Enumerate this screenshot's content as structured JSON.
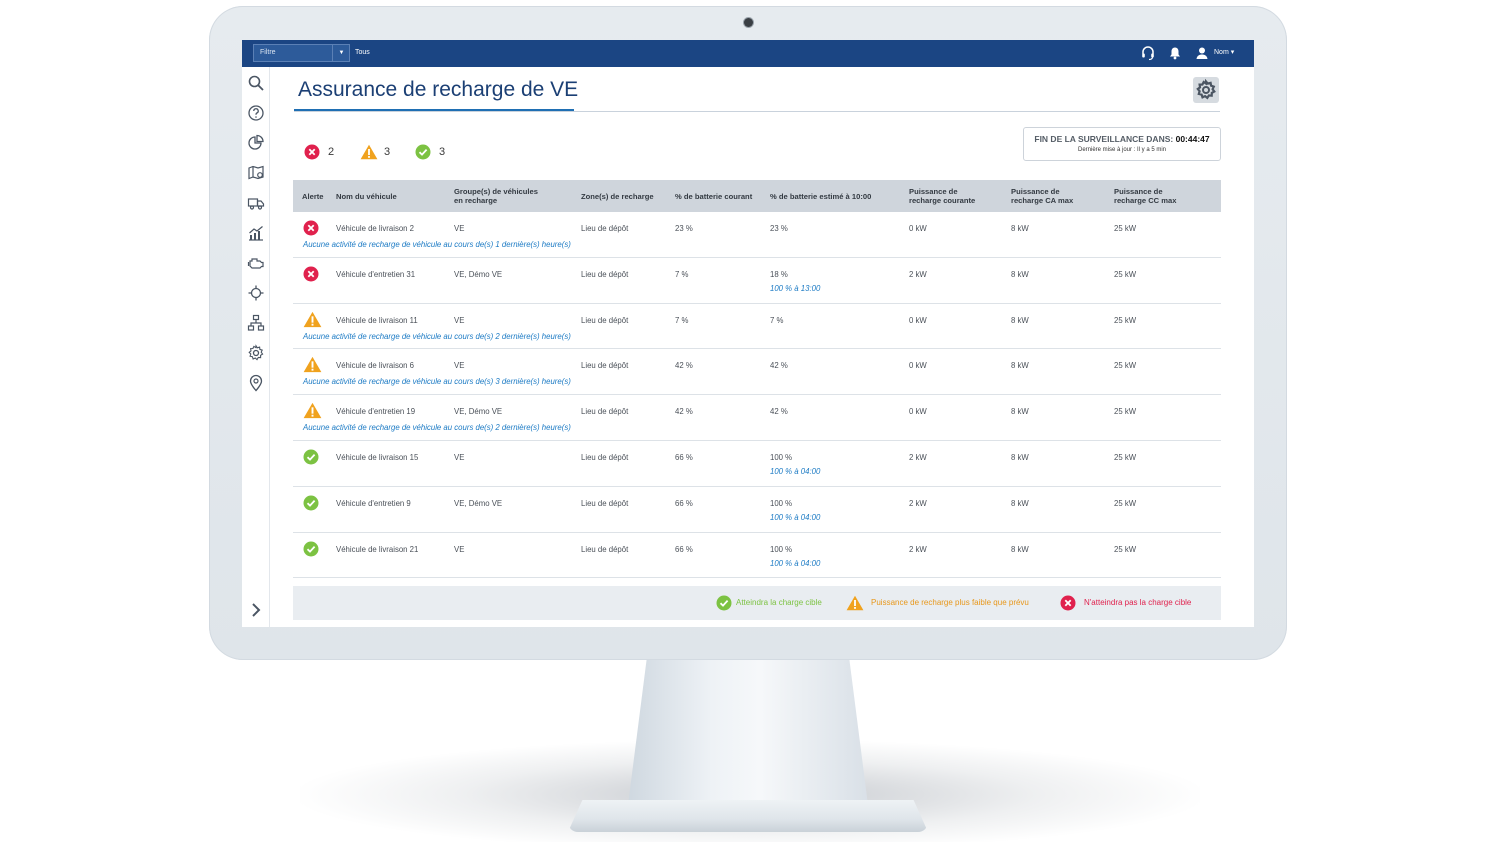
{
  "topbar": {
    "filter_label": "Filtre",
    "filter_value": "Tous",
    "user_name": "Nom ▾"
  },
  "page": {
    "title": "Assurance de recharge de VE"
  },
  "counters": {
    "red": "2",
    "orange": "3",
    "green": "3"
  },
  "timer": {
    "label": "FIN DE LA SURVEILLANCE DANS:",
    "value": "00:44:47",
    "last_update": "Dernière mise à jour : Il y a 5 min"
  },
  "table": {
    "headers": {
      "alert": "Alerte",
      "name": "Nom du véhicule",
      "groups_l1": "Groupe(s) de véhicules",
      "groups_l2": "en recharge",
      "zone": "Zone(s) de recharge",
      "battery": "% de batterie courant",
      "estimated": "% de batterie estimé à 10:00",
      "power_l1": "Puissance de",
      "power_l2": "recharge courante",
      "ac_l1": "Puissance de",
      "ac_l2": "recharge CA max",
      "dc_l1": "Puissance de",
      "dc_l2": "recharge CC max"
    },
    "rows": [
      {
        "status": "red",
        "name": "Véhicule de livraison 2",
        "groups": "VE",
        "zone": "Lieu de dépôt",
        "battery": "23 %",
        "estimated": "23 %",
        "estimated_note": "",
        "power": "0 kW",
        "ac": "8 kW",
        "dc": "25 kW",
        "note": "Aucune activité de recharge de véhicule au cours de(s) 1 dernière(s) heure(s)"
      },
      {
        "status": "red",
        "name": "Véhicule d'entretien 31",
        "groups": "VE, Démo VE",
        "zone": "Lieu de dépôt",
        "battery": "7 %",
        "estimated": "18 %",
        "estimated_note": "100 % à 13:00",
        "power": "2 kW",
        "ac": "8 kW",
        "dc": "25 kW",
        "note": ""
      },
      {
        "status": "orange",
        "name": "Véhicule de livraison 11",
        "groups": "VE",
        "zone": "Lieu de dépôt",
        "battery": "7 %",
        "estimated": "7 %",
        "estimated_note": "",
        "power": "0 kW",
        "ac": "8 kW",
        "dc": "25 kW",
        "note": "Aucune activité de recharge de véhicule au cours de(s) 2 dernière(s) heure(s)"
      },
      {
        "status": "orange",
        "name": "Véhicule de livraison 6",
        "groups": "VE",
        "zone": "Lieu de dépôt",
        "battery": "42 %",
        "estimated": "42 %",
        "estimated_note": "",
        "power": "0 kW",
        "ac": "8 kW",
        "dc": "25 kW",
        "note": "Aucune activité de recharge de véhicule au cours de(s) 3 dernière(s) heure(s)"
      },
      {
        "status": "orange",
        "name": "Véhicule d'entretien 19",
        "groups": "VE, Démo VE",
        "zone": "Lieu de dépôt",
        "battery": "42 %",
        "estimated": "42 %",
        "estimated_note": "",
        "power": "0 kW",
        "ac": "8 kW",
        "dc": "25 kW",
        "note": "Aucune activité de recharge de véhicule au cours de(s) 2 dernière(s) heure(s)"
      },
      {
        "status": "green",
        "name": "Véhicule de livraison 15",
        "groups": "VE",
        "zone": "Lieu de dépôt",
        "battery": "66 %",
        "estimated": "100 %",
        "estimated_note": "100 % à 04:00",
        "power": "2 kW",
        "ac": "8 kW",
        "dc": "25 kW",
        "note": ""
      },
      {
        "status": "green",
        "name": "Véhicule d'entretien 9",
        "groups": "VE, Démo VE",
        "zone": "Lieu de dépôt",
        "battery": "66 %",
        "estimated": "100 %",
        "estimated_note": "100 % à 04:00",
        "power": "2 kW",
        "ac": "8 kW",
        "dc": "25 kW",
        "note": ""
      },
      {
        "status": "green",
        "name": "Véhicule de livraison 21",
        "groups": "VE",
        "zone": "Lieu de dépôt",
        "battery": "66 %",
        "estimated": "100 %",
        "estimated_note": "100 % à 04:00",
        "power": "2 kW",
        "ac": "8 kW",
        "dc": "25 kW",
        "note": ""
      }
    ]
  },
  "legend": {
    "green": "Atteindra la charge cible",
    "orange": "Puissance de recharge plus faible que prévu",
    "red": "N'atteindra pas la charge cible"
  },
  "colors": {
    "red": "#e0214d",
    "orange": "#f0a21e",
    "green": "#7cc242",
    "topbar": "#1b4583",
    "title": "#1b3f74",
    "link": "#1b7ac4"
  }
}
